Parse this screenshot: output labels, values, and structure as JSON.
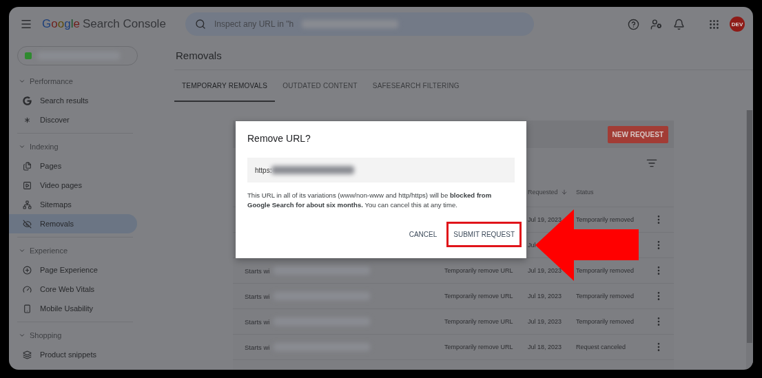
{
  "header": {
    "logo_word": "Google",
    "product": "Search Console",
    "search_placeholder": "Inspect any URL in \"h",
    "avatar": "DEV"
  },
  "sidebar": {
    "sections": [
      {
        "title": "Performance",
        "expanded": true,
        "items": [
          {
            "label": "Search results",
            "selected": false
          },
          {
            "label": "Discover",
            "selected": false
          }
        ]
      },
      {
        "title": "Indexing",
        "expanded": true,
        "items": [
          {
            "label": "Pages",
            "selected": false
          },
          {
            "label": "Video pages",
            "selected": false
          },
          {
            "label": "Sitemaps",
            "selected": false
          },
          {
            "label": "Removals",
            "selected": true
          }
        ]
      },
      {
        "title": "Experience",
        "expanded": true,
        "items": [
          {
            "label": "Page Experience",
            "selected": false
          },
          {
            "label": "Core Web Vitals",
            "selected": false
          },
          {
            "label": "Mobile Usability",
            "selected": false
          }
        ]
      },
      {
        "title": "Shopping",
        "expanded": true,
        "items": [
          {
            "label": "Product snippets",
            "selected": false
          }
        ]
      }
    ]
  },
  "page_title": "Removals",
  "tabs": [
    {
      "label": "TEMPORARY REMOVALS",
      "selected": true
    },
    {
      "label": "OUTDATED CONTENT",
      "selected": false
    },
    {
      "label": "SAFESEARCH FILTERING",
      "selected": false
    }
  ],
  "table": {
    "new_request": "NEW REQUEST",
    "columns": [
      {
        "label": "Requested",
        "sorted": true
      },
      {
        "label": "Status",
        "sorted": false
      }
    ],
    "rows": [
      {
        "date": "Jul 19, 2023",
        "status": "Temporarily removed"
      },
      {
        "date": "Jul"
      },
      {
        "column_1": "Starts wi",
        "type": "Temporarily remove URL",
        "date": "Jul 19, 2023",
        "status": "Temporarily removed"
      },
      {
        "column_1": "Starts wi",
        "type": "Temporarily remove URL",
        "date": "Jul 19, 2023",
        "status": "Temporarily removed"
      },
      {
        "column_1": "Starts wi",
        "type": "Temporarily remove URL",
        "date": "Jul 19, 2023",
        "status": "Temporarily removed"
      },
      {
        "column_1": "Starts wi",
        "type": "Temporarily remove URL",
        "date": "Jul 18, 2023",
        "status": "Request canceled"
      }
    ]
  },
  "dialog": {
    "title": "Remove URL?",
    "url_prefix": "https:",
    "message": "This URL in all of its variations (www/non-www and http/https) will be **blocked from Google Search for about six months.** You can cancel this at any time.",
    "cancel": "CANCEL",
    "submit": "SUBMIT REQUEST",
    "submit_highlighted": true
  }
}
